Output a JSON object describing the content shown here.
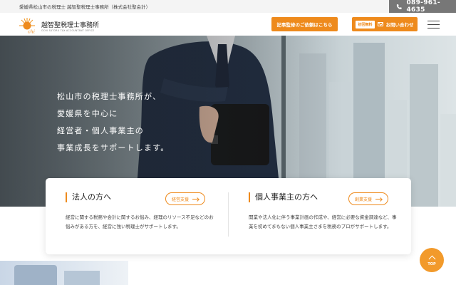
{
  "topbar": {
    "tagline": "愛媛県松山市の税理士 越智聖税理士事務所（株式会社聖会計）",
    "phone": "089-961-4635",
    "phone_icon": "phone-icon"
  },
  "header": {
    "logo_text": "越智聖税理士事務所",
    "logo_sub": "OCHI SATORU TAX ACCOUNTANT OFFICE",
    "logo_mark": "chi",
    "supervise_button": "記事監修のご依頼はこちら",
    "contact_badge": "初回無料",
    "contact_button": "お問い合わせ",
    "menu_icon": "hamburger-icon"
  },
  "hero": {
    "lines": [
      "松山市の税理士事務所が、",
      "愛媛県を中心に",
      "経営者・個人事業主の",
      "事業成長をサポートします。"
    ]
  },
  "cards": {
    "corporate": {
      "title": "法人の方へ",
      "button": "経営支援",
      "description": "経営に関する税務や会計に関するお悩み、経理のリソース不足などのお悩みがある方を、経営に強い税理士がサポートします。"
    },
    "individual": {
      "title": "個人事業主の方へ",
      "button": "創業支援",
      "description": "開業や法人化に伴う事業計画の作成や、経営に必要な資金調達など、事業を初めてまもない個人事業主さまを税務のプロがサポートします。"
    }
  },
  "totop": {
    "label": "TOP"
  },
  "colors": {
    "accent": "#ee8a1c",
    "phone_bg": "#777777"
  }
}
